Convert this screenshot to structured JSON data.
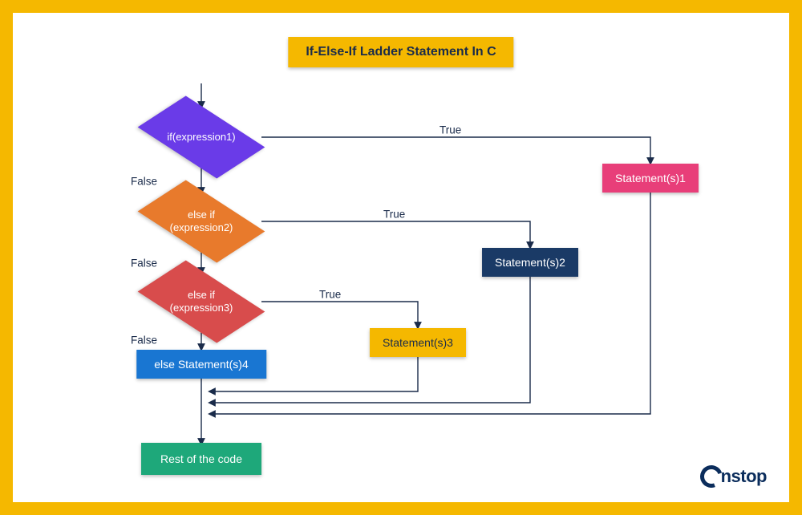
{
  "title": "If-Else-If Ladder Statement In C",
  "nodes": {
    "d1": "if(expression1)",
    "d2": "else if\n(expression2)",
    "d3": "else if\n(expression3)",
    "s1": "Statement(s)1",
    "s2": "Statement(s)2",
    "s3": "Statement(s)3",
    "s4": "else Statement(s)4",
    "rest": "Rest of the code"
  },
  "labels": {
    "true": "True",
    "false": "False"
  },
  "logo": "nstop"
}
